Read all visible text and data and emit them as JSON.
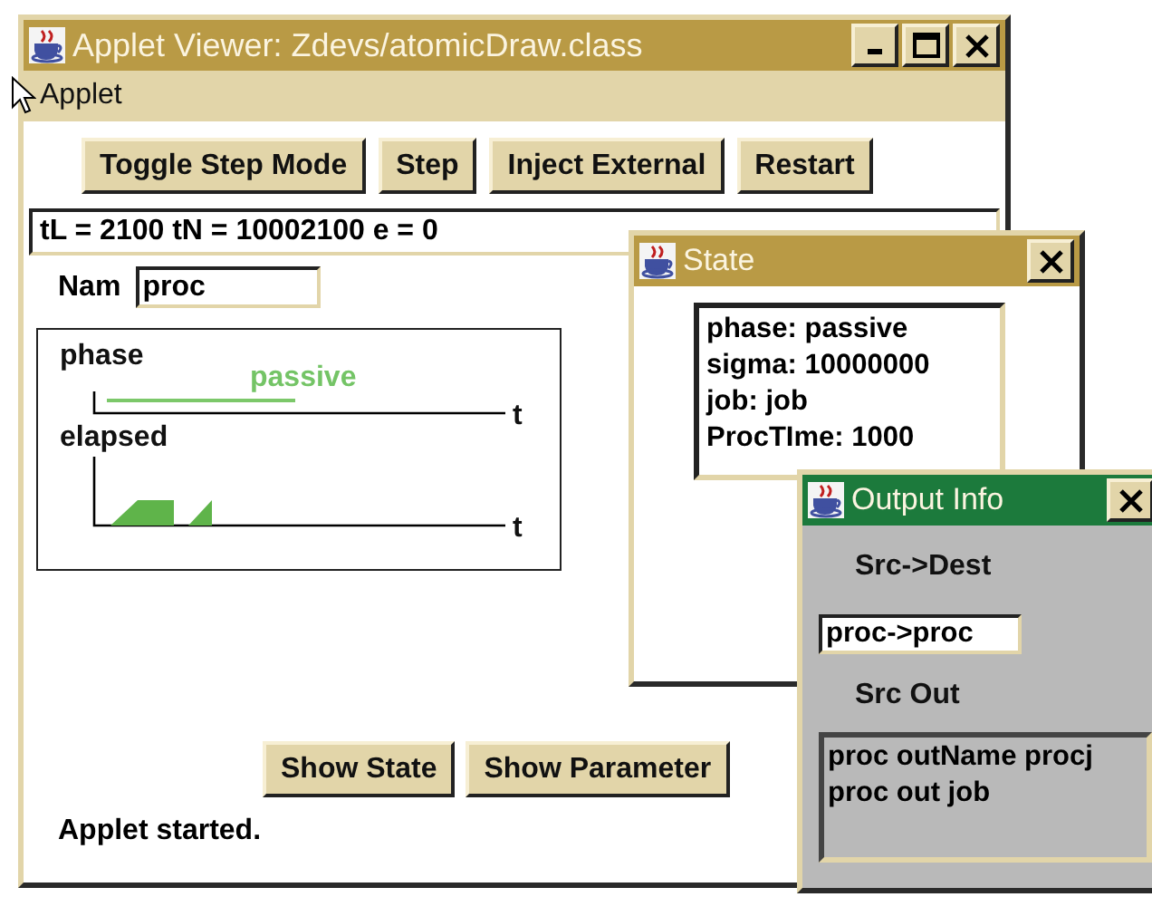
{
  "main_window": {
    "title": "Applet Viewer: Zdevs/atomicDraw.class",
    "title_buttons": [
      {
        "kind": "minimize"
      },
      {
        "kind": "maximize"
      },
      {
        "kind": "close"
      }
    ],
    "menu": [
      "Applet"
    ],
    "toolbar_buttons": [
      "Toggle Step Mode",
      "Step",
      "Inject External",
      "Restart"
    ],
    "time_line": "tL = 2100 tN = 10002100 e =  0",
    "name_field": {
      "label": "Nam",
      "value": "proc"
    },
    "plot": {
      "tracks": [
        {
          "kind": "phase",
          "label": "phase",
          "state_label": "passive",
          "axis_label": "t"
        },
        {
          "kind": "elapsed",
          "label": "elapsed",
          "axis_label": "t"
        }
      ]
    },
    "bottom_buttons": [
      "Show State",
      "Show Parameter"
    ],
    "status": "Applet started."
  },
  "state_window": {
    "title": "State",
    "lines": [
      "phase: passive",
      "sigma: 10000000",
      "job: job",
      "ProcTIme: 1000"
    ]
  },
  "output_window": {
    "title": "Output Info",
    "src_dest_label": "Src->Dest",
    "src_dest_value": "proc->proc",
    "src_out_label": "Src Out",
    "src_out_lines": [
      "proc outName procj",
      "proc out job"
    ]
  }
}
